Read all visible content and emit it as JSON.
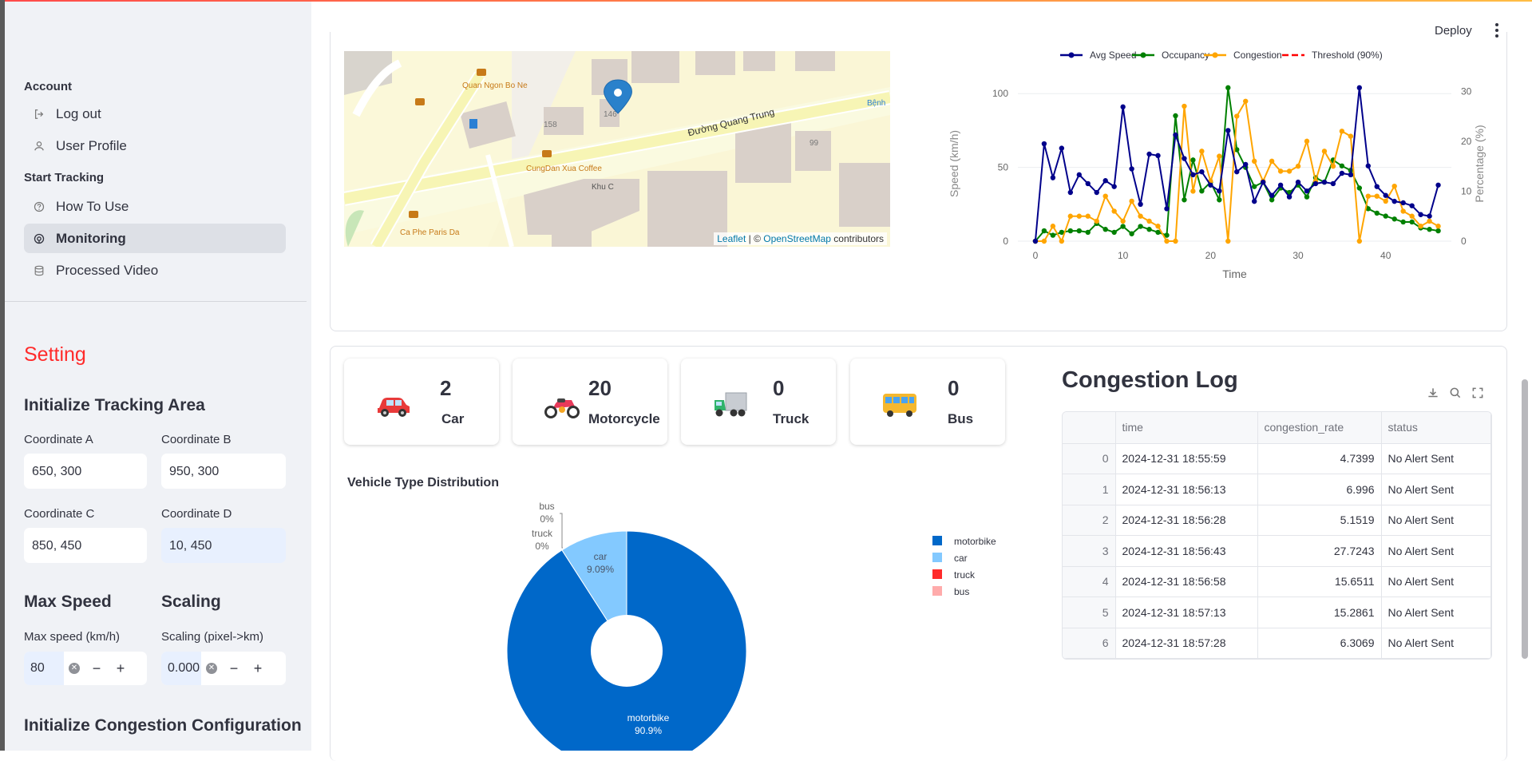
{
  "sidebar": {
    "account_section": "Account",
    "account_items": [
      {
        "label": "Log out",
        "icon": "logout-icon"
      },
      {
        "label": "User Profile",
        "icon": "user-icon"
      }
    ],
    "tracking_section": "Start Tracking",
    "tracking_items": [
      {
        "label": "How To Use",
        "icon": "help-icon",
        "active": false
      },
      {
        "label": "Monitoring",
        "icon": "monitoring-icon",
        "active": true
      },
      {
        "label": "Processed Video",
        "icon": "database-icon",
        "active": false
      }
    ],
    "setting_title": "Setting",
    "tracking_area_title": "Initialize Tracking Area",
    "coord_a_label": "Coordinate A",
    "coord_a_value": "650, 300",
    "coord_b_label": "Coordinate B",
    "coord_b_value": "950, 300",
    "coord_c_label": "Coordinate C",
    "coord_c_value": "850, 450",
    "coord_d_label": "Coordinate D",
    "coord_d_value": "10, 450",
    "max_speed_title": "Max Speed",
    "max_speed_label": "Max speed (km/h)",
    "max_speed_value": "80",
    "scaling_title": "Scaling",
    "scaling_label": "Scaling (pixel->km)",
    "scaling_value": "0.000",
    "congestion_config_title": "Initialize Congestion Configuration"
  },
  "header": {
    "deploy_label": "Deploy"
  },
  "map": {
    "labels": [
      "Quan Ngon Bo Ne",
      "Đường Quang Trung",
      "CungDan Xua Coffee",
      "Khu C",
      "Ca Phe Paris Da",
      "158",
      "146",
      "99",
      "Bệnh"
    ],
    "attribution_leaflet": "Leaflet",
    "attribution_sep": " | © ",
    "attribution_osm": "OpenStreetMap",
    "attribution_tail": " contributors"
  },
  "colors": {
    "accent_red": "#ff4b4b",
    "avg_speed": "#00008b",
    "occupancy": "#008000",
    "congestion": "#ffa500",
    "threshold": "#ff0000",
    "pie_motorbike": "#0068c9",
    "pie_car": "#83c9ff",
    "pie_truck": "#ff2b2b",
    "pie_bus": "#ffabab"
  },
  "line_chart": {
    "legend": [
      "Avg Speed",
      "Occupancy",
      "Congestion",
      "Threshold (90%)"
    ],
    "xlabel": "Time",
    "ylabel_left": "Speed (km/h)",
    "ylabel_right": "Percentage (%)"
  },
  "vehicles": [
    {
      "count": "2",
      "label": "Car",
      "icon": "car-icon"
    },
    {
      "count": "20",
      "label": "Motorcycle",
      "icon": "motorcycle-icon"
    },
    {
      "count": "0",
      "label": "Truck",
      "icon": "truck-icon"
    },
    {
      "count": "0",
      "label": "Bus",
      "icon": "bus-icon"
    }
  ],
  "pie": {
    "title": "Vehicle Type Distribution",
    "legend": [
      "motorbike",
      "car",
      "truck",
      "bus"
    ]
  },
  "log": {
    "title": "Congestion Log",
    "columns": [
      "",
      "time",
      "congestion_rate",
      "status"
    ],
    "rows": [
      [
        "0",
        "2024-12-31 18:55:59",
        "4.7399",
        "No Alert Sent"
      ],
      [
        "1",
        "2024-12-31 18:56:13",
        "6.996",
        "No Alert Sent"
      ],
      [
        "2",
        "2024-12-31 18:56:28",
        "5.1519",
        "No Alert Sent"
      ],
      [
        "3",
        "2024-12-31 18:56:43",
        "27.7243",
        "No Alert Sent"
      ],
      [
        "4",
        "2024-12-31 18:56:58",
        "15.6511",
        "No Alert Sent"
      ],
      [
        "5",
        "2024-12-31 18:57:13",
        "15.2861",
        "No Alert Sent"
      ],
      [
        "6",
        "2024-12-31 18:57:28",
        "6.3069",
        "No Alert Sent"
      ]
    ]
  },
  "chart_data": [
    {
      "type": "line",
      "xlabel": "Time",
      "ylabel": "Speed (km/h)",
      "y2label": "Percentage (%)",
      "xlim": [
        -2,
        47.5
      ],
      "ylim": [
        0,
        105
      ],
      "y2lim": [
        0,
        31
      ],
      "xticks": [
        0,
        10,
        20,
        30,
        40
      ],
      "yticks": [
        0,
        50,
        100
      ],
      "y2ticks": [
        0,
        10,
        20,
        30
      ],
      "legend_position": "top",
      "x": [
        0,
        1,
        2,
        3,
        4,
        5,
        6,
        7,
        8,
        9,
        10,
        11,
        12,
        13,
        14,
        15,
        16,
        17,
        18,
        19,
        20,
        21,
        22,
        23,
        24,
        25,
        26,
        27,
        28,
        29,
        30,
        31,
        32,
        33,
        34,
        35,
        36,
        37,
        38,
        39,
        40,
        41,
        42,
        43,
        44,
        45,
        46
      ],
      "series": [
        {
          "name": "Avg Speed",
          "axis": "left",
          "values": [
            0,
            66,
            43,
            63,
            33,
            45,
            39,
            33,
            41,
            37,
            91,
            49,
            25,
            59,
            58,
            22,
            72,
            56,
            45,
            47,
            38,
            34,
            75,
            47,
            52,
            27,
            40,
            31,
            38,
            30,
            40,
            34,
            39,
            40,
            39,
            46,
            45,
            104,
            51,
            37,
            31,
            27,
            26,
            24,
            18,
            17,
            38
          ]
        },
        {
          "name": "Occupancy",
          "axis": "left",
          "values": [
            0,
            7,
            4,
            6,
            7,
            7,
            6,
            12,
            8,
            6,
            10,
            5,
            10,
            8,
            6,
            4,
            85,
            28,
            55,
            34,
            40,
            28,
            104,
            62,
            50,
            37,
            40,
            28,
            36,
            33,
            38,
            30,
            43,
            40,
            55,
            51,
            48,
            36,
            22,
            19,
            17,
            15,
            13,
            13,
            9,
            8,
            7
          ]
        },
        {
          "name": "Congestion",
          "axis": "right",
          "values": [
            0,
            0,
            3,
            0,
            5,
            5,
            5,
            4,
            9,
            6,
            4,
            8,
            5,
            4,
            3,
            0,
            0,
            27,
            10,
            18,
            12,
            17,
            0,
            25,
            28,
            16,
            12,
            16,
            14,
            14,
            15,
            20,
            12,
            18,
            15,
            22,
            21,
            0,
            9,
            9,
            8,
            11,
            6,
            5,
            3,
            4,
            3
          ]
        },
        {
          "name": "Threshold (90%)",
          "axis": "right",
          "values": []
        }
      ]
    },
    {
      "type": "pie",
      "title": "Vehicle Type Distribution",
      "categories": [
        "motorbike",
        "car",
        "truck",
        "bus"
      ],
      "values": [
        90.9,
        9.09,
        0,
        0
      ],
      "labels": [
        "90.9%",
        "9.09%",
        "0%",
        "0%"
      ],
      "hole": true,
      "legend_position": "right"
    }
  ]
}
